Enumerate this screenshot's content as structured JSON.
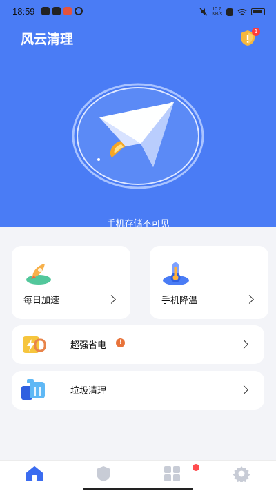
{
  "status_bar": {
    "time": "18:59",
    "speed": "10.7\nKB/s"
  },
  "header": {
    "title": "风云清理",
    "badge_count": "1"
  },
  "hero": {
    "caption": "手机存储不可见"
  },
  "cards": {
    "speed_up": {
      "label": "每日加速"
    },
    "cool_down": {
      "label": "手机降温"
    },
    "power_save": {
      "label": "超强省电"
    },
    "junk_clean": {
      "label": "垃圾清理"
    }
  },
  "colors": {
    "hero_bg": "#4a7cf5",
    "accent": "#3b6cf0",
    "badge": "#ff3b3b"
  },
  "bottom_nav": [
    "home-icon",
    "shield-icon",
    "apps-grid-icon",
    "settings-gear-icon"
  ]
}
